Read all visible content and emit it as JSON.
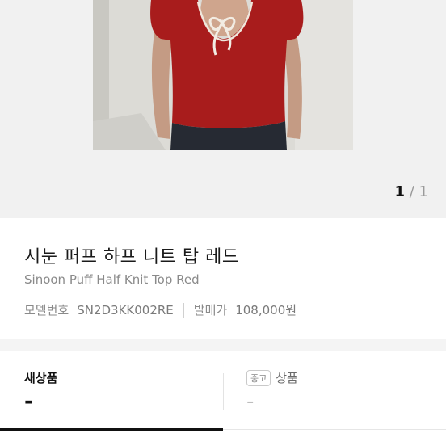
{
  "gallery": {
    "image_alt": "Red knit top product photo",
    "current": "1",
    "separator": "/",
    "total": "1"
  },
  "product": {
    "title": "시눈 퍼프 하프 니트 탑 레드",
    "subtitle": "Sinoon Puff Half Knit Top Red",
    "model_label": "모델번호",
    "model_value": "SN2D3KK002RE",
    "release_price_label": "발매가",
    "release_price_value": "108,000원"
  },
  "tabs": {
    "new": {
      "label": "새상품",
      "price": "-"
    },
    "used": {
      "badge": "중고",
      "label": "상품",
      "price": "-"
    }
  },
  "colors": {
    "shirt": "#a81c1c",
    "background": "#f1f1f1"
  }
}
